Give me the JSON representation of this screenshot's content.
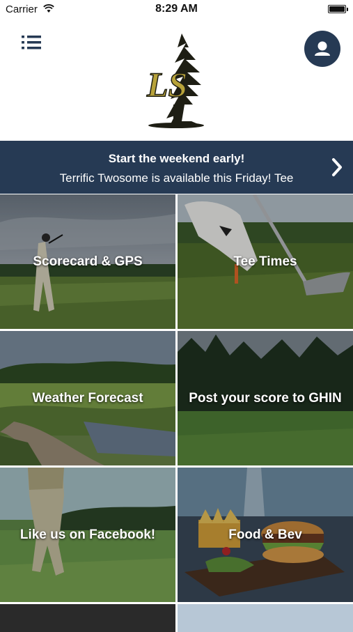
{
  "status_bar": {
    "carrier": "Carrier",
    "time": "8:29 AM"
  },
  "header": {
    "menu_icon": "list-icon",
    "profile_icon": "person-icon",
    "logo_text": "LS",
    "accent": "#263a54",
    "logo_gold": "#b7a23a"
  },
  "banner": {
    "title": "Start the weekend early!",
    "subtitle": "Terrific Twosome is available this Friday! Tee",
    "chevron_icon": "chevron-right-icon"
  },
  "tiles": [
    {
      "label": "Scorecard & GPS"
    },
    {
      "label": "Tee Times"
    },
    {
      "label": "Weather Forecast"
    },
    {
      "label": "Post your score to GHIN"
    },
    {
      "label": "Like us on Facebook!"
    },
    {
      "label": "Food & Bev"
    }
  ]
}
